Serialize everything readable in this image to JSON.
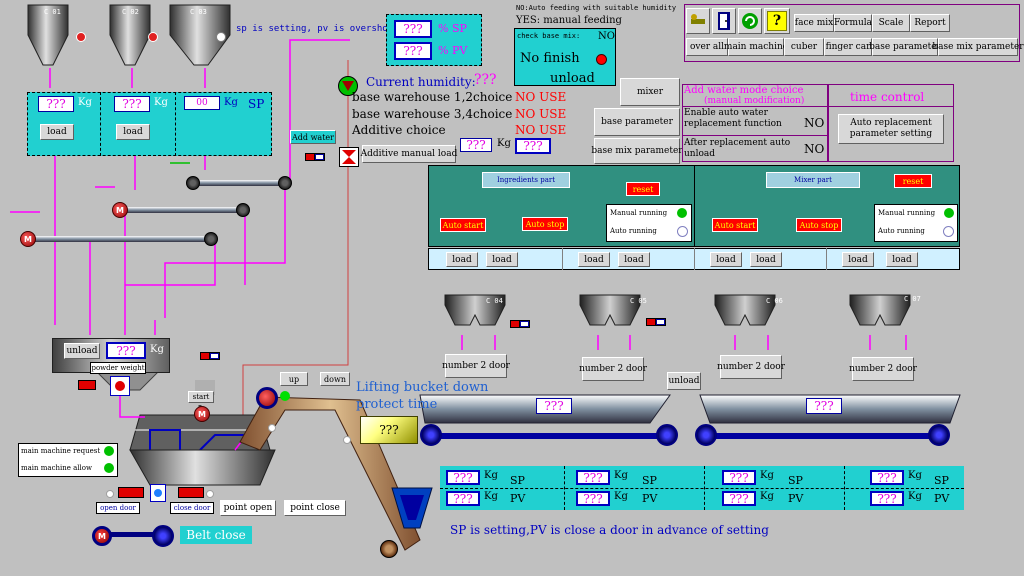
{
  "colors": {
    "bg": "#c0c0c0",
    "cyan": "#21d0d0",
    "teal": "#30a090",
    "pink": "#ff00ff",
    "red": "#ff0000",
    "blue": "#0000c0"
  },
  "placeholder": "???",
  "silos": [
    {
      "label": "C 01"
    },
    {
      "label": "C 02"
    },
    {
      "label": "C 03"
    }
  ],
  "overshoot_note": "sp is setting, pv is overshoot",
  "hopper_panel": {
    "kg_unit": "Kg",
    "sp_label": "SP",
    "third_value": "00",
    "load_label": "load"
  },
  "sp_pv_panel": {
    "sp": "%  SP",
    "pv": "%  PV"
  },
  "feeding": {
    "line1": "NO:Auto feeding with suitable humidity",
    "line2": "YES: manual feeding"
  },
  "check_base_mix": {
    "title": "check base mix:",
    "no": "NO",
    "status": "No finish",
    "unload": "unload"
  },
  "humidity": {
    "label": "Current humidity:"
  },
  "choices": [
    {
      "label": "base warehouse 1,2choice",
      "value": "NO USE"
    },
    {
      "label": "base warehouse 3,4choice",
      "value": "NO USE"
    },
    {
      "label": "Additive choice",
      "value": "NO USE"
    }
  ],
  "add_water": "Add water",
  "additive_manual_load": "Additive manual load",
  "kg": "Kg",
  "mid_buttons": {
    "mixer": "mixer",
    "base_parameter": "base parameter",
    "base_mix_parameter": "base mix parameter"
  },
  "water_mode": {
    "title": "Add water mode choice",
    "subtitle": "(manual modification)",
    "enable_label": "Enable auto water replacement function",
    "enable_value": "NO",
    "after_label": "After  replacement auto unload",
    "after_value": "NO"
  },
  "time_control": {
    "title": "time control",
    "button": "Auto replacement parameter setting"
  },
  "top_menu": {
    "row1": [
      "face mix",
      "Formula",
      "Scale",
      "Report"
    ],
    "row2": [
      "over all",
      "main machine",
      "cuber",
      "finger car",
      "base parameter",
      "base mix parameter"
    ]
  },
  "ingredients": {
    "title": "Ingredients part",
    "reset": "reset",
    "auto_start": "Auto start",
    "auto_stop": "Auto stop",
    "manual": "Manual running",
    "auto": "Auto running"
  },
  "mixer_part": {
    "title": "Mixer part",
    "reset": "reset",
    "auto_start": "Auto start",
    "auto_stop": "Auto stop",
    "manual": "Manual running",
    "auto": "Auto running"
  },
  "load_buttons": "load",
  "bins": [
    {
      "label": "C 04"
    },
    {
      "label": "C 05"
    },
    {
      "label": "C 06"
    },
    {
      "label": "C 07"
    }
  ],
  "number2door": "number 2 door",
  "unload": "unload",
  "powder": {
    "unload": "unload",
    "kg": "Kg",
    "title": "powder weight"
  },
  "motor_letter": "M",
  "start": "start",
  "main_machine": {
    "request": "main machine request",
    "allow": "main machine allow"
  },
  "doors": {
    "open": "open door",
    "close": "close door",
    "point_open": "point open",
    "point_close": "point close"
  },
  "belt_close": "Belt close",
  "bucket": {
    "up": "up",
    "down": "down",
    "warning_line1": "Lifting bucket down",
    "warning_line2": "protect time"
  },
  "bottom_table": {
    "sp": "SP",
    "pv": "PV",
    "kg": "Kg"
  },
  "bottom_note": "SP is setting,PV is close a door in advance of setting"
}
